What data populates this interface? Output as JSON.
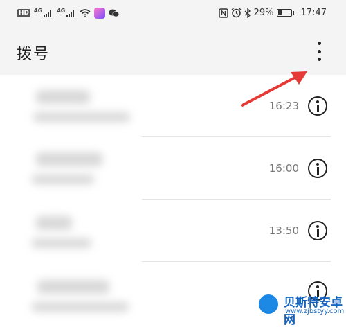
{
  "status_bar": {
    "hd_label": "HD",
    "network_1": "4G",
    "network_2": "4G",
    "battery_percent_text": "29%",
    "battery_level": 0.29,
    "time": "17:47",
    "icons": [
      "signal-icon",
      "wifi-icon",
      "app-notification-icon",
      "wechat-icon",
      "nfc-icon",
      "alarm-icon",
      "bluetooth-icon",
      "battery-icon"
    ]
  },
  "header": {
    "title": "拨号",
    "more_icon": "more-vertical-icon"
  },
  "call_log": [
    {
      "time": "16:23"
    },
    {
      "time": "16:00"
    },
    {
      "time": "13:50"
    },
    {
      "time": ""
    }
  ],
  "annotation": {
    "arrow_color": "#e53935"
  },
  "watermark": {
    "title": "贝斯特安卓网",
    "url": "www.zjbstyy.com"
  }
}
